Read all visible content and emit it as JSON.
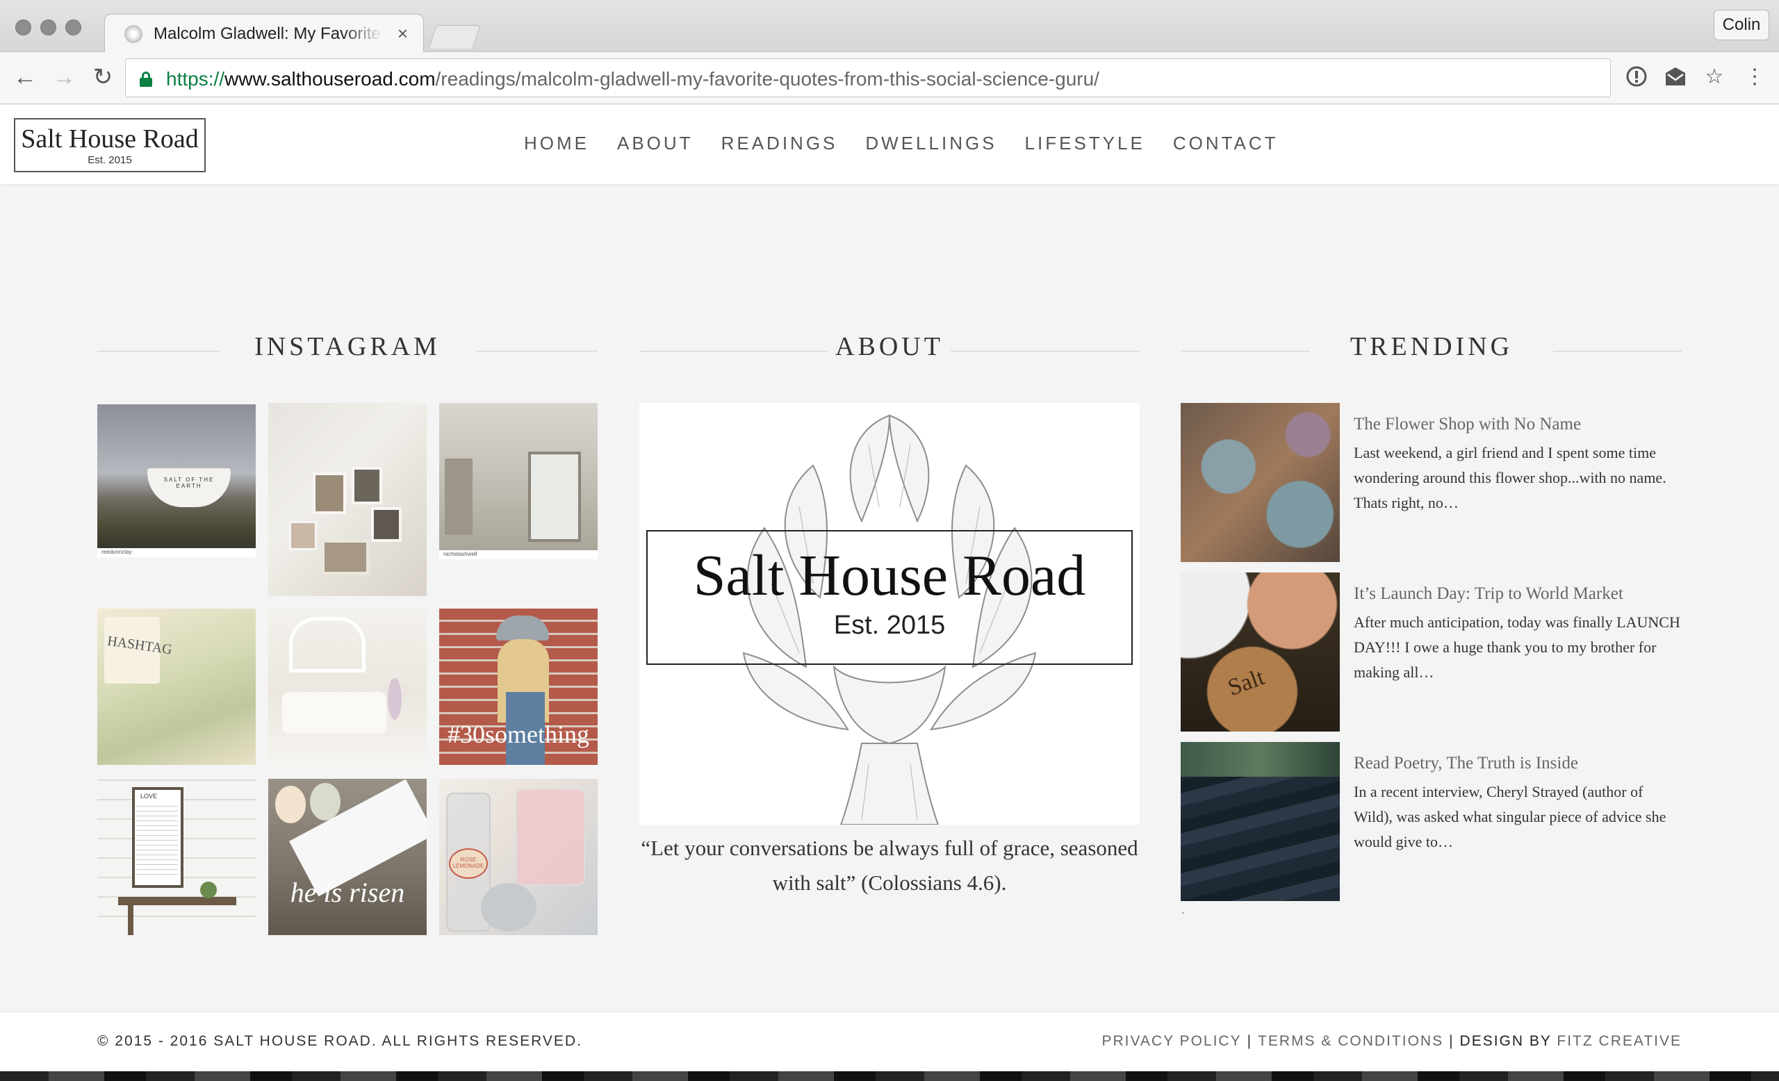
{
  "browser": {
    "tab_title": "Malcolm Gladwell: My Favorite Quotes from This Social Science Guru",
    "tab_close": "×",
    "profile_label": "Colin",
    "url_scheme": "https://",
    "url_host": "www.salthouseroad.com",
    "url_path": "/readings/malcolm-gladwell-my-favorite-quotes-from-this-social-science-guru/"
  },
  "site": {
    "logo_name": "Salt House Road",
    "logo_est": "Est. 2015",
    "nav": [
      "HOME",
      "ABOUT",
      "READINGS",
      "DWELLINGS",
      "LIFESTYLE",
      "CONTACT"
    ]
  },
  "instagram": {
    "heading": "INSTAGRAM",
    "tiles": [
      {
        "text": "SALT OF THE EARTH",
        "caption": "reedunnclay"
      },
      {
        "text": "",
        "caption": ""
      },
      {
        "text": "",
        "caption": "rachelashwell"
      },
      {
        "text": "HASHTAG",
        "caption": ""
      },
      {
        "text": "",
        "caption": ""
      },
      {
        "text": "#30something",
        "caption": ""
      },
      {
        "text": "LOVE",
        "caption": ""
      },
      {
        "text": "he is risen",
        "caption": ""
      },
      {
        "text": "ROSE LEMONADE",
        "caption": ""
      }
    ]
  },
  "about": {
    "heading": "ABOUT",
    "logo_name": "Salt House Road",
    "logo_est": "Est. 2015",
    "quote": "“Let your conversations be always full of grace, seasoned with salt” (Colossians 4.6)."
  },
  "trending": {
    "heading": "TRENDING",
    "posts": [
      {
        "title": "The Flower Shop with No Name",
        "excerpt": "Last weekend, a girl friend and I spent some time wondering around this flower shop...with no name. Thats right, no…"
      },
      {
        "title": "It’s Launch Day: Trip to World Market",
        "excerpt": "After much anticipation, today was finally LAUNCH DAY!!! I owe a huge thank you to my brother for making all…"
      },
      {
        "title": "Read Poetry, The Truth is Inside",
        "excerpt": "In a recent interview, Cheryl Strayed (author of Wild), was asked what singular piece of advice she would give to…"
      }
    ],
    "trailing_dot": "."
  },
  "footer": {
    "copyright": "© 2015 - 2016 SALT HOUSE ROAD. ALL RIGHTS RESERVED.",
    "privacy": "PRIVACY POLICY",
    "terms": "TERMS & CONDITIONS",
    "design_by": "DESIGN BY",
    "designer": "FITZ CREATIVE",
    "separator": "|"
  },
  "colors": {
    "page_bg": "#f4f4f4",
    "header_bg": "#ffffff",
    "secure_green": "#0b8043",
    "text_dark": "#333333"
  }
}
